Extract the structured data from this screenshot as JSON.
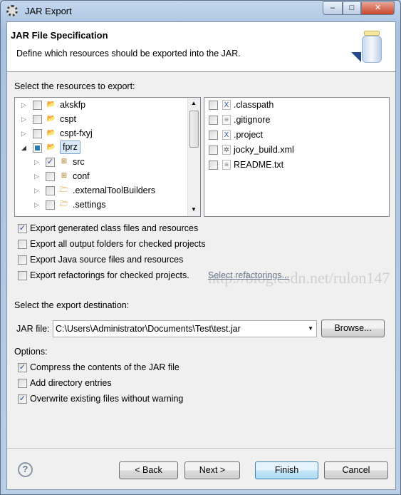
{
  "window": {
    "title": "JAR Export",
    "controls": [
      "minimize",
      "maximize",
      "close"
    ]
  },
  "header": {
    "title": "JAR File Specification",
    "description": "Define which resources should be exported into the JAR.",
    "icon": "jar-icon"
  },
  "resources_label": "Select the resources to export:",
  "tree": [
    {
      "label": "akskfp",
      "checked": false,
      "expanded": false,
      "level": 0,
      "icon": "project-error-icon"
    },
    {
      "label": "cspt",
      "checked": false,
      "expanded": false,
      "level": 0,
      "icon": "project-error-icon"
    },
    {
      "label": "cspt-fxyj",
      "checked": false,
      "expanded": false,
      "level": 0,
      "icon": "project-error-icon"
    },
    {
      "label": "fprz",
      "checked": "partial",
      "expanded": true,
      "selected": true,
      "level": 0,
      "icon": "project-error-icon"
    },
    {
      "label": "src",
      "checked": true,
      "expanded": false,
      "level": 1,
      "icon": "package-warning-icon"
    },
    {
      "label": "conf",
      "checked": false,
      "expanded": false,
      "level": 1,
      "icon": "package-warning-icon"
    },
    {
      "label": ".externalToolBuilders",
      "checked": false,
      "expanded": false,
      "level": 1,
      "icon": "folder-icon"
    },
    {
      "label": ".settings",
      "checked": false,
      "expanded": false,
      "level": 1,
      "icon": "folder-icon"
    }
  ],
  "files": [
    {
      "label": ".classpath",
      "checked": false,
      "icon": "xml-file-icon"
    },
    {
      "label": ".gitignore",
      "checked": false,
      "icon": "text-file-icon"
    },
    {
      "label": ".project",
      "checked": false,
      "icon": "xml-file-icon"
    },
    {
      "label": "jocky_build.xml",
      "checked": false,
      "icon": "ant-file-icon"
    },
    {
      "label": "README.txt",
      "checked": false,
      "icon": "text-file-icon"
    }
  ],
  "export_options": [
    {
      "label": "Export generated class files and resources",
      "checked": true
    },
    {
      "label": "Export all output folders for checked projects",
      "checked": false
    },
    {
      "label": "Export Java source files and resources",
      "checked": false
    },
    {
      "label": "Export refactorings for checked projects.",
      "checked": false
    }
  ],
  "select_refactorings_link": "Select refactorings...",
  "watermark": "http://blog.csdn.net/rulon147",
  "destination_label": "Select the export destination:",
  "jar_file_label": "JAR file:",
  "jar_file_value": "C:\\Users\\Administrator\\Documents\\Test\\test.jar",
  "browse_label": "Browse...",
  "options_label": "Options:",
  "options": [
    {
      "label": "Compress the contents of the JAR file",
      "checked": true
    },
    {
      "label": "Add directory entries",
      "checked": false
    },
    {
      "label": "Overwrite existing files without warning",
      "checked": true
    }
  ],
  "buttons": {
    "back": "< Back",
    "next": "Next >",
    "finish": "Finish",
    "cancel": "Cancel"
  }
}
